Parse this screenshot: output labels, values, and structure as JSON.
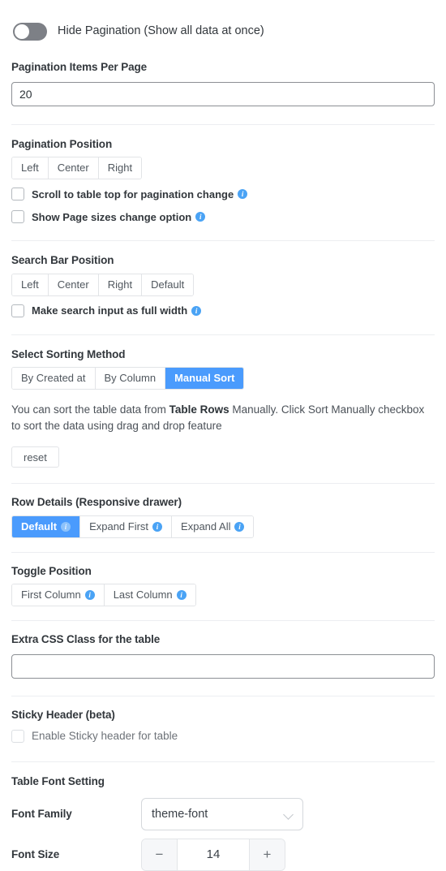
{
  "hide_pagination": {
    "label": "Hide Pagination (Show all data at once)",
    "state": "off"
  },
  "items_per_page": {
    "label": "Pagination Items Per Page",
    "value": "20"
  },
  "pagination_position": {
    "label": "Pagination Position",
    "options": [
      "Left",
      "Center",
      "Right"
    ],
    "checkboxes": [
      {
        "label": "Scroll to table top for pagination change",
        "checked": false,
        "info": true
      },
      {
        "label": "Show Page sizes change option",
        "checked": false,
        "info": true
      }
    ]
  },
  "search_bar_position": {
    "label": "Search Bar Position",
    "options": [
      "Left",
      "Center",
      "Right",
      "Default"
    ],
    "checkboxes": [
      {
        "label": "Make search input as full width",
        "checked": false,
        "info": true
      }
    ]
  },
  "sorting_method": {
    "label": "Select Sorting Method",
    "options": [
      "By Created at",
      "By Column",
      "Manual Sort"
    ],
    "selected": "Manual Sort",
    "help_prefix": "You can sort the table data from ",
    "help_bold": "Table Rows",
    "help_suffix": " Manually. Click Sort Manually checkbox to sort the data using drag and drop feature",
    "reset_label": "reset"
  },
  "row_details": {
    "label": "Row Details (Responsive drawer)",
    "options": [
      "Default",
      "Expand First",
      "Expand All"
    ],
    "selected": "Default"
  },
  "toggle_position": {
    "label": "Toggle Position",
    "options": [
      "First Column",
      "Last Column"
    ]
  },
  "extra_css": {
    "label": "Extra CSS Class for the table",
    "value": "",
    "placeholder": ""
  },
  "sticky_header": {
    "label": "Sticky Header (beta)",
    "checkbox_label": "Enable Sticky header for table",
    "checked": false
  },
  "font_setting": {
    "label": "Table Font Setting",
    "font_family_label": "Font Family",
    "font_family_value": "theme-font",
    "font_size_label": "Font Size",
    "font_size_value": "14",
    "minus_label": "−",
    "plus_label": "+"
  },
  "colors": {
    "accent": "#4a9bfd",
    "info": "#4aa3f5",
    "divider": "#eceef1",
    "text": "#32373c"
  }
}
